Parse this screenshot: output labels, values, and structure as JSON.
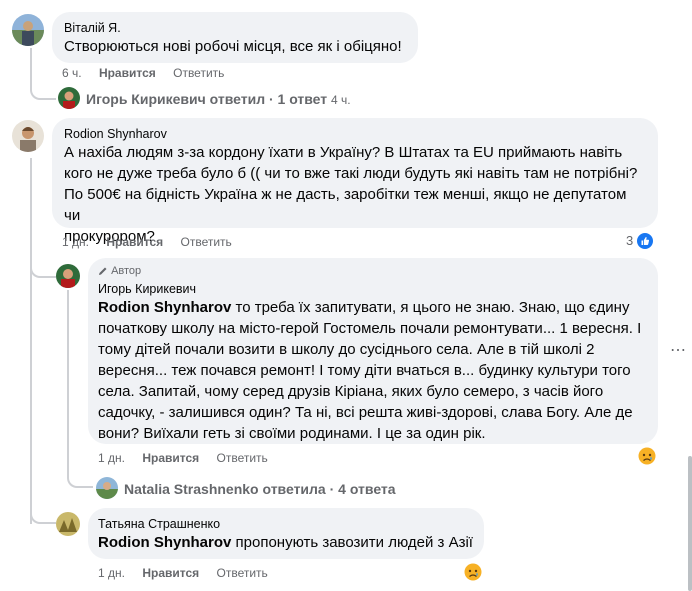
{
  "comments": [
    {
      "author": "Віталій Я.",
      "text": "Створюються нові робочі місця, все як і обіцяно!",
      "time": "6 ч.",
      "like_label": "Нравится",
      "reply_label": "Ответить"
    },
    {
      "author": "Rodion Shynharov",
      "lines": [
        "А нахіба людям з-за кордону їхати в Україну? В Штатах та EU приймають навіть",
        "кого не дуже треба було б (( чи то вже такі люди будуть які навіть там не потрібні?",
        "По 500€ на бідність Україна ж не дасть, заробітки теж менші, якщо не депутатом чи",
        "прокурором?"
      ],
      "time": "1 дн.",
      "like_label": "Нравится",
      "reply_label": "Ответить",
      "reaction_count": "3"
    },
    {
      "badge": "Автор",
      "author": "Игорь Кирикевич",
      "mention": "Rodion Shynharov",
      "lines": [
        " то треба їх запитувати, я цього не знаю. Знаю, що єдину",
        "початкову школу на місто-герой Гостомель почали ремонтувати... 1 вересня. І",
        "тому дітей почали возити в школу до сусіднього села. Але в тій школі 2",
        "вересня... теж почався ремонт! І тому діти вчаться в... будинку культури того",
        "села. Запитай, чому серед друзів Кіріана, яких було семеро, з часів його",
        "садочку, - залишився один? Та ні, всі решта живі-здорові, слава Богу. Але де",
        "вони? Виїхали геть зі своїми родинами. І це за один рік."
      ],
      "time": "1 дн.",
      "like_label": "Нравится",
      "reply_label": "Ответить"
    },
    {
      "author": "Татьяна Страшненко",
      "mention": "Rodion Shynharov",
      "text": " пропонують завозити людей з Азії",
      "time": "1 дн.",
      "like_label": "Нравится",
      "reply_label": "Ответить"
    }
  ],
  "replies_summary_1": {
    "text": "Игорь Кирикевич ответил · 1 ответ",
    "time": "4 ч."
  },
  "replies_summary_2": {
    "text": "Natalia Strashnenko ответила · 4 ответа"
  },
  "more_icon": "⋯"
}
